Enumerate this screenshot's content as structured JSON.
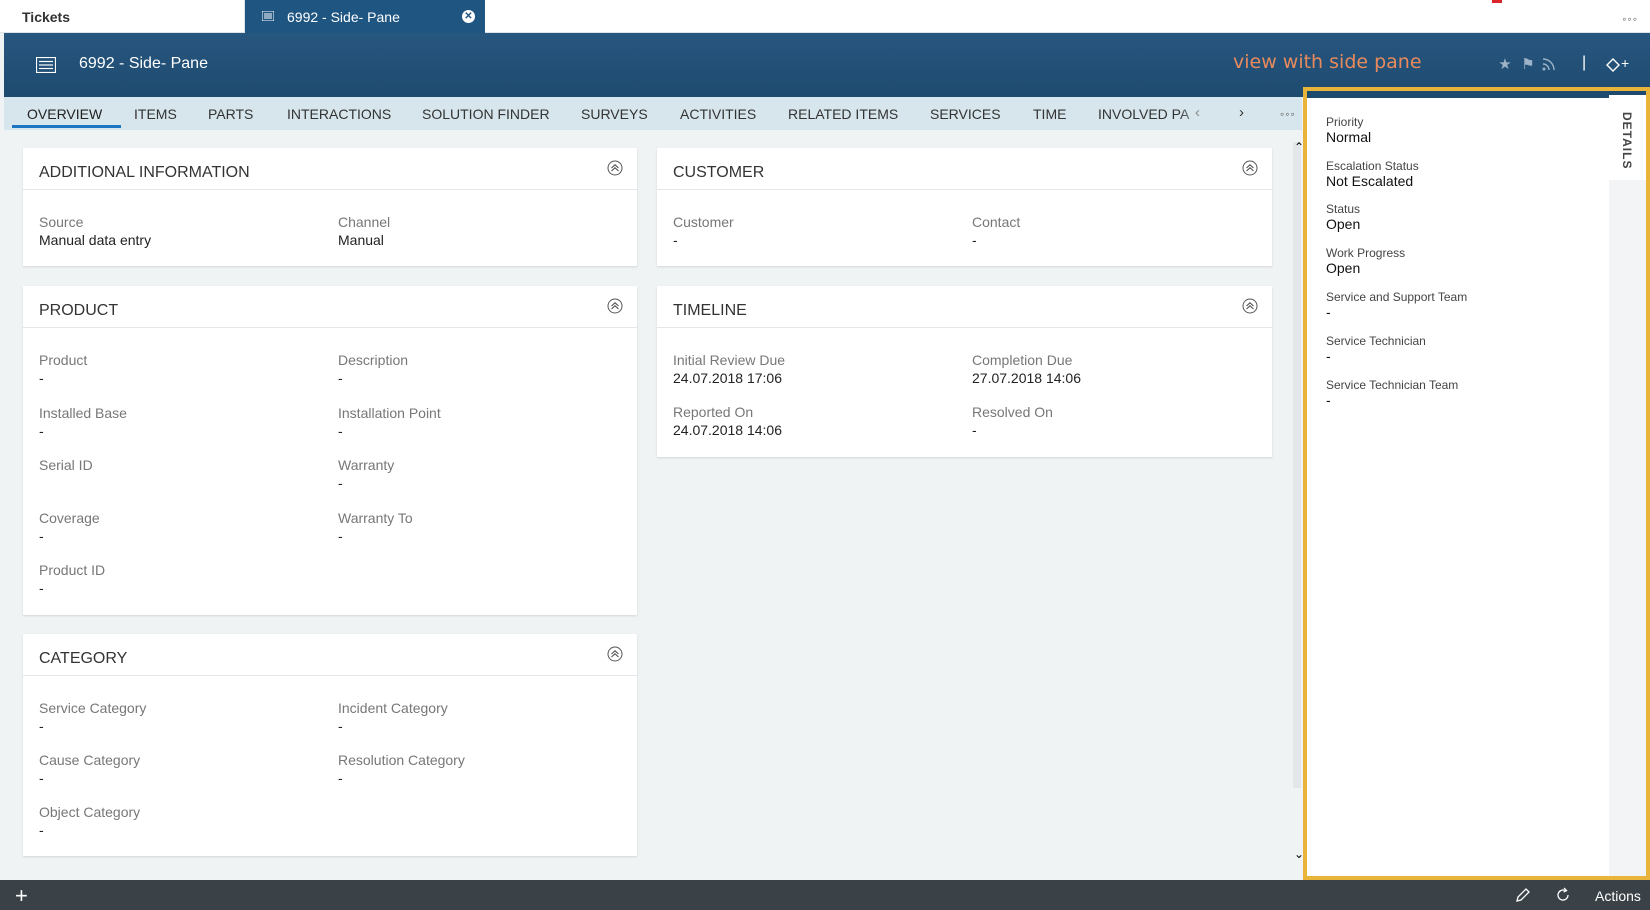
{
  "tabs": {
    "home_label": "Tickets",
    "active_label": "6992 - Side- Pane",
    "more": "◦◦◦"
  },
  "header": {
    "title": "6992 - Side- Pane",
    "annotation": "view with side pane",
    "separator": "|",
    "add": "+"
  },
  "nav": {
    "items": [
      "OVERVIEW",
      "ITEMS",
      "PARTS",
      "INTERACTIONS",
      "SOLUTION FINDER",
      "SURVEYS",
      "ACTIVITIES",
      "RELATED ITEMS",
      "SERVICES",
      "TIME",
      "INVOLVED PA"
    ],
    "prev": "‹",
    "next": "›",
    "more": "◦◦◦"
  },
  "cards": {
    "additional": {
      "title": "ADDITIONAL INFORMATION",
      "source_label": "Source",
      "source_value": "Manual data entry",
      "channel_label": "Channel",
      "channel_value": "Manual"
    },
    "customer": {
      "title": "CUSTOMER",
      "customer_label": "Customer",
      "customer_value": "-",
      "contact_label": "Contact",
      "contact_value": "-"
    },
    "product": {
      "title": "PRODUCT",
      "product_label": "Product",
      "product_value": "-",
      "description_label": "Description",
      "description_value": "-",
      "installed_base_label": "Installed Base",
      "installed_base_value": "-",
      "installation_point_label": "Installation Point",
      "installation_point_value": "-",
      "serial_label": "Serial ID",
      "serial_value": "",
      "warranty_label": "Warranty",
      "warranty_value": "-",
      "coverage_label": "Coverage",
      "coverage_value": "-",
      "warranty_to_label": "Warranty To",
      "warranty_to_value": "-",
      "product_id_label": "Product ID",
      "product_id_value": "-"
    },
    "timeline": {
      "title": "TIMELINE",
      "initial_review_label": "Initial Review Due",
      "initial_review_value": "24.07.2018 17:06",
      "completion_label": "Completion Due",
      "completion_value": "27.07.2018 14:06",
      "reported_label": "Reported On",
      "reported_value": "24.07.2018 14:06",
      "resolved_label": "Resolved On",
      "resolved_value": "-"
    },
    "category": {
      "title": "CATEGORY",
      "service_label": "Service Category",
      "service_value": "-",
      "incident_label": "Incident Category",
      "incident_value": "-",
      "cause_label": "Cause Category",
      "cause_value": "-",
      "resolution_label": "Resolution Category",
      "resolution_value": "-",
      "object_label": "Object Category",
      "object_value": "-"
    }
  },
  "side_pane": {
    "tab_label": "DETAILS",
    "fields": [
      {
        "label": "Priority",
        "value": "Normal"
      },
      {
        "label": "Escalation Status",
        "value": "Not Escalated"
      },
      {
        "label": "Status",
        "value": "Open"
      },
      {
        "label": "Work Progress",
        "value": "Open"
      },
      {
        "label": "Service and Support Team",
        "value": "-"
      },
      {
        "label": "Service Technician",
        "value": "-"
      },
      {
        "label": "Service Technician Team",
        "value": "-"
      }
    ]
  },
  "bottom": {
    "add": "+",
    "actions": "Actions"
  },
  "colors": {
    "header_bg": "#1e4a6f",
    "active_tab": "#1f5581",
    "nav_bg": "#d7e6ec",
    "highlight_border": "#e8b53a",
    "annotation_text": "#e98a5d",
    "bottom_bar": "#3a4248"
  },
  "icons": [
    "list-icon",
    "close-icon",
    "star-icon",
    "flag-icon",
    "rss-icon",
    "tag-add-icon",
    "collapse-icon",
    "edit-icon",
    "refresh-icon",
    "plus-icon",
    "more-icon"
  ]
}
